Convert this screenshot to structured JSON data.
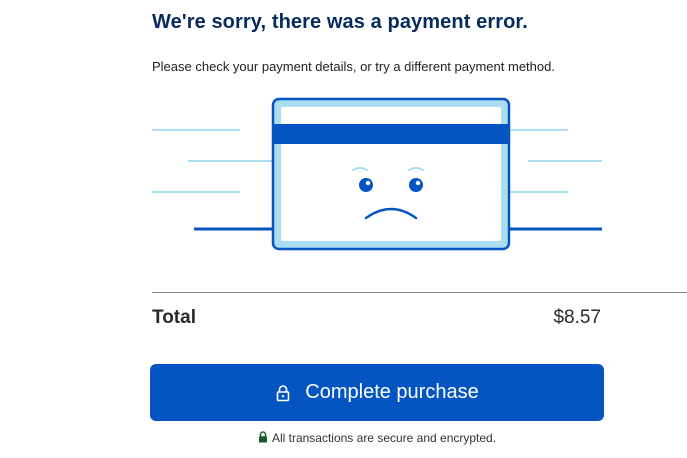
{
  "error": {
    "title": "We're sorry, there was a payment error.",
    "message": "Please check your payment details, or try a different payment method."
  },
  "summary": {
    "total_label": "Total",
    "total_value": "$8.57"
  },
  "actions": {
    "purchase_label": "Complete purchase",
    "purchase_icon": "lock-icon"
  },
  "footer": {
    "security_note": "All transactions are secure and encrypted.",
    "security_icon": "lock-icon"
  },
  "colors": {
    "title": "#062a5c",
    "button": "#0455c2",
    "card_stripe": "#0455c2",
    "card_light": "#a9dff0",
    "secure_lock": "#1f5a2e"
  }
}
